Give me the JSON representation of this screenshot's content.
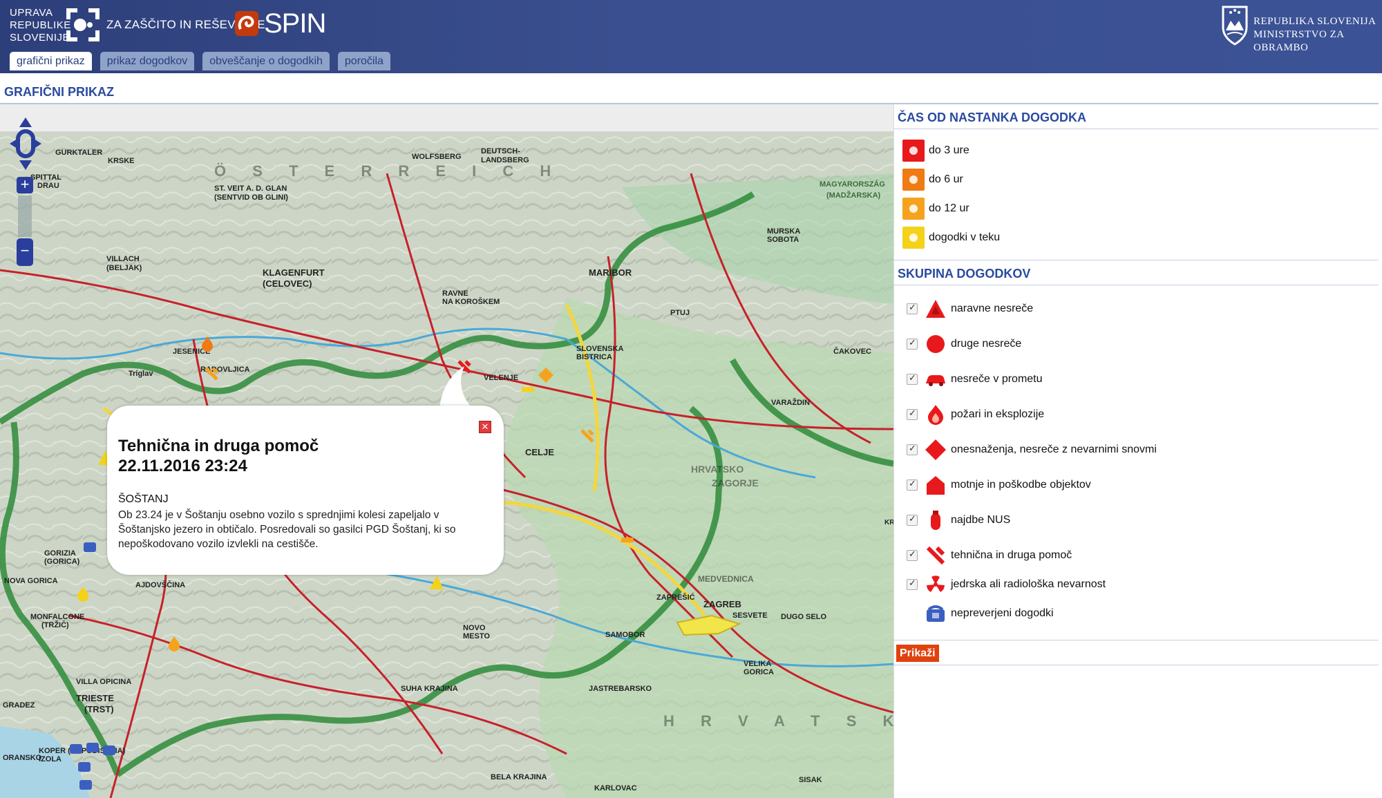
{
  "header": {
    "agency_line1": "UPRAVA",
    "agency_line2": "REPUBLIKE",
    "agency_line3": "SLOVENIJE",
    "agency_sub": "ZA ZAŠČITO IN REŠEVANJE",
    "app_name": "SPIN",
    "ministry_line1": "REPUBLIKA SLOVENIJA",
    "ministry_line2": "MINISTRSTVO ZA OBRAMBO"
  },
  "tabs": [
    {
      "label": "grafični prikaz",
      "active": true
    },
    {
      "label": "prikaz dogodkov",
      "active": false
    },
    {
      "label": "obveščanje o dogodkih",
      "active": false
    },
    {
      "label": "poročila",
      "active": false
    }
  ],
  "page_title": "GRAFIČNI PRIKAZ",
  "map": {
    "labels": {
      "gurktaler": "GURKTALER",
      "krske": "KRSKE",
      "wolfsberg": "WOLFSBERG",
      "deutsch": "DEUTSCH-",
      "landsberg": "LANDSBERG",
      "spittal": "SPITTAL",
      "drau": "DRAU",
      "stveit": "ST. VEIT A. D. GLAN",
      "sentvid": "(SENTVID OB GLINI)",
      "villach": "VILLACH",
      "beljak": "(BELJAK)",
      "klagenfurt": "KLAGENFURT",
      "celovec": "(CELOVEC)",
      "maribor": "MARIBOR",
      "ptuj": "PTUJ",
      "murska": "MURSKA",
      "sobota": "SOBOTA",
      "varazdin": "VARAŽDIN",
      "cakovec": "ČAKOVEC",
      "velenje": "VELENJE",
      "celje": "CELJE",
      "slovenska": "SLOVENSKA",
      "bistrica": "BISTRICA",
      "jesenice": "JESENICE",
      "radovljica": "RADOVLJICA",
      "triglav": "Triglav",
      "zagreb": "ZAGREB",
      "samobor": "SAMOBOR",
      "novo_mesto": "NOVO",
      "mesto": "MESTO",
      "gorizia": "GORIZIA",
      "gorica": "(GORICA)",
      "trieste": "TRIESTE",
      "trst": "(TRST)",
      "koper": "KOPER (CAPODISTRIA)",
      "izola": "IZOLA",
      "piranski": "ORANSKO",
      "velika_gorica": "VELIKA",
      "gorica2": "GORICA",
      "karlovac": "KARLOVAC",
      "sisak": "SISAK",
      "zapresic": "ZAPREŠIĆ",
      "krizevci": "KRIŽEVCI",
      "osterreich": "Ö S T E R R E I C H",
      "hrvatska": "H R V A T S K A",
      "magyar": "MAGYARORSZÁG",
      "madzarska": "(MADŽARSKA)",
      "medvednica": "MEDVEDNICA",
      "hrvatsko": "HRVATSKO",
      "zagorje": "ZAGORJE",
      "jastrebarsko": "JASTREBARSKO",
      "villa_opicina": "VILLA OPICINA",
      "monfalcone": "MONFALCONE",
      "trzic": "(TRŽIČ)",
      "grado": "GRADEZ",
      "nova_gorica": "NOVA GORICA",
      "ajdovscina": "AJDOVŠČINA",
      "sesvete": "SESVETE",
      "dugo_selo": "DUGO SELO",
      "ravne": "RAVNE",
      "na_koroskem": "NA KOROŠKEM",
      "bela_krajina": "BELA KRAJINA",
      "suha_krajina": "SUHA KRAJINA"
    }
  },
  "popup": {
    "title": "Tehnična in druga pomoč",
    "datetime": "22.11.2016 23:24",
    "place": "ŠOŠTANJ",
    "body": "Ob 23.24 je v Šoštanju osebno vozilo s sprednjimi kolesi zapeljalo v Šoštanjsko jezero in obtičalo. Posredovali so gasilci PGD Šoštanj, ki so nepoškodovano vozilo izvlekli na cestišče."
  },
  "time_legend": {
    "title": "ČAS OD NASTANKA DOGODKA",
    "items": [
      {
        "label": "do 3 ure",
        "color": "#e8191c"
      },
      {
        "label": "do 6 ur",
        "color": "#f07b14"
      },
      {
        "label": "do 12 ur",
        "color": "#f5a31e"
      },
      {
        "label": "dogodki v teku",
        "color": "#f4d21a"
      }
    ]
  },
  "groups": {
    "title": "SKUPINA DOGODKOV",
    "items": [
      {
        "label": "naravne nesreče",
        "icon": "natural-disaster-icon",
        "checked": true
      },
      {
        "label": "druge nesreče",
        "icon": "other-accident-icon",
        "checked": true
      },
      {
        "label": "nesreče v prometu",
        "icon": "traffic-accident-icon",
        "checked": true
      },
      {
        "label": "požari in eksplozije",
        "icon": "fire-icon",
        "checked": true
      },
      {
        "label": "onesnaženja, nesreče z nevarnimi snovmi",
        "icon": "hazmat-icon",
        "checked": true
      },
      {
        "label": "motnje in poškodbe objektov",
        "icon": "building-damage-icon",
        "checked": true
      },
      {
        "label": "najdbe NUS",
        "icon": "unexploded-ordnance-icon",
        "checked": true
      },
      {
        "label": "tehnična in druga pomoč",
        "icon": "technical-aid-icon",
        "checked": true
      },
      {
        "label": "jedrska ali radiološka nevarnost",
        "icon": "radiation-icon",
        "checked": true
      },
      {
        "label": "nepreverjeni dogodki",
        "icon": "unverified-phone-icon",
        "checked": null
      }
    ],
    "show_button": "Prikaži"
  },
  "colors": {
    "header": "#34498a",
    "accent_title": "#2a4aa0",
    "show_button": "#e0420e",
    "road_red": "#c8202a",
    "border_green": "#2e8b3a"
  }
}
